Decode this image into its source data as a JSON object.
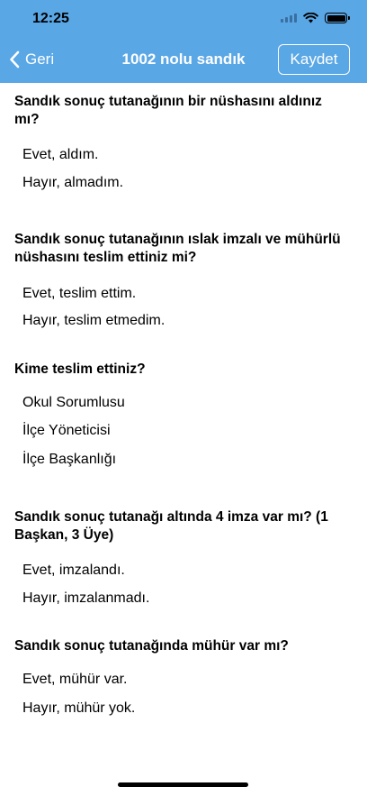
{
  "status_bar": {
    "time": "12:25"
  },
  "nav": {
    "back_label": "Geri",
    "title": "1002 nolu sandık",
    "save_label": "Kaydet"
  },
  "questions": [
    {
      "text": "Sandık sonuç tutanağının bir nüshasını aldınız mı?",
      "options": [
        "Evet, aldım.",
        "Hayır, almadım."
      ]
    },
    {
      "text": "Sandık sonuç tutanağının ıslak imzalı ve mühürlü nüshasını teslim ettiniz mi?",
      "options": [
        "Evet, teslim ettim.",
        "Hayır, teslim etmedim."
      ]
    },
    {
      "text": "Kime teslim ettiniz?",
      "options": [
        "Okul Sorumlusu",
        "İlçe Yöneticisi",
        "İlçe Başkanlığı"
      ]
    },
    {
      "text": "Sandık sonuç tutanağı altında 4 imza var mı? (1 Başkan, 3 Üye)",
      "options": [
        "Evet, imzalandı.",
        "Hayır, imzalanmadı."
      ]
    },
    {
      "text": "Sandık sonuç tutanağında mühür var mı?",
      "options": [
        "Evet, mühür var.",
        "Hayır, mühür yok."
      ]
    }
  ],
  "icons": {
    "back": "chevron-left-icon",
    "wifi": "wifi-icon",
    "signal": "cellular-signal-icon",
    "battery": "battery-icon"
  },
  "colors": {
    "header": "#5aa7e6",
    "nav_text": "#ffffff",
    "body_text": "#000000"
  }
}
